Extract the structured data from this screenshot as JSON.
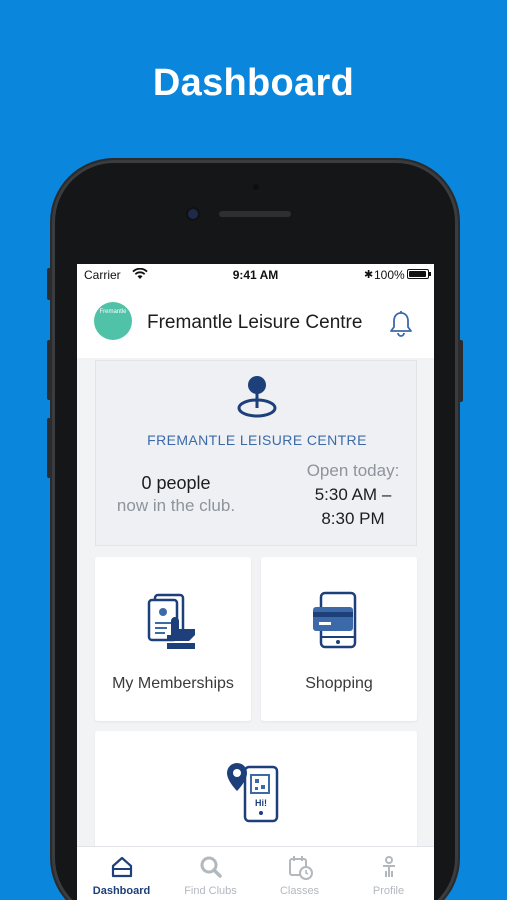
{
  "promo": {
    "title": "Dashboard"
  },
  "status_bar": {
    "carrier": "Carrier",
    "time": "9:41 AM",
    "battery": "100%"
  },
  "header": {
    "club_name": "Fremantle Leisure Centre",
    "logo_text": "Fremantle"
  },
  "club_card": {
    "club_label": "FREMANTLE LEISURE CENTRE",
    "people_count": "0 people",
    "people_sub": "now in the club.",
    "open_label": "Open today:",
    "open_hours_line1": "5:30 AM –",
    "open_hours_line2": "8:30 PM"
  },
  "tiles": {
    "memberships_label": "My Memberships",
    "shopping_label": "Shopping",
    "checkin_badge": "Hi!"
  },
  "nav": {
    "items": [
      {
        "label": "Dashboard",
        "icon": "home-icon"
      },
      {
        "label": "Find Clubs",
        "icon": "search-icon"
      },
      {
        "label": "Classes",
        "icon": "calendar-clock-icon"
      },
      {
        "label": "Profile",
        "icon": "person-icon"
      }
    ],
    "active": "Dashboard"
  },
  "colors": {
    "background": "#0a86dc",
    "accent_navy": "#1d3f7a",
    "accent_blue": "#3c6aa9",
    "logo_green": "#4fc2a8"
  }
}
